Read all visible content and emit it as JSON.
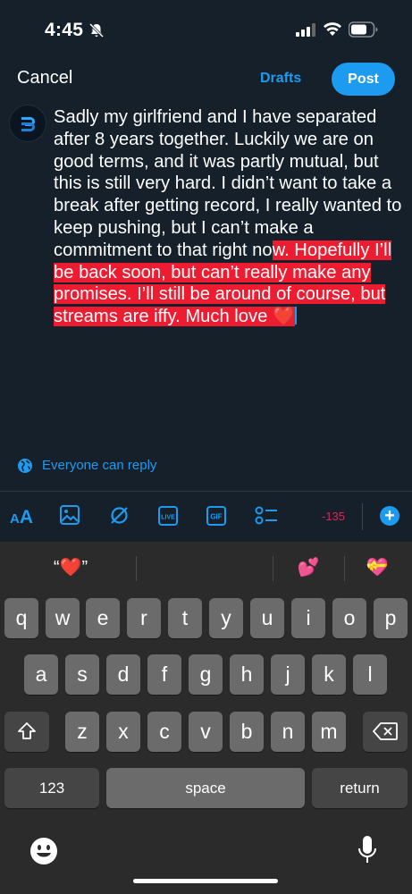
{
  "status_bar": {
    "time": "4:45"
  },
  "header": {
    "cancel_label": "Cancel",
    "drafts_label": "Drafts",
    "post_label": "Post"
  },
  "composer": {
    "text_plain": "Sadly my girlfriend and I have separated after 8 years together. Luckily we are on good terms, and it was partly mutual, but this is still very hard. I didn’t want to take a break after getting record, I really wanted to keep pushing, but I can’t make a commitment to that right no",
    "text_highlighted": "w. Hopefully I’ll be back soon, but can’t really make any promises. I’ll still be around of course, but streams are iffy. Much love ❤️"
  },
  "reply_setting": {
    "label": "Everyone can reply",
    "icon": "globe-icon"
  },
  "toolbar": {
    "text_size_label": "A",
    "text_size_small_label": "A",
    "char_count": "-135",
    "icons": [
      "text-size-icon",
      "image-icon",
      "gif-search-icon",
      "live-icon",
      "gif-icon",
      "poll-icon",
      "add-thread-icon"
    ],
    "live_label": "LIVE",
    "gif_label": "GIF"
  },
  "keyboard": {
    "suggestions": [
      "“❤️”",
      "💕",
      "💝"
    ],
    "row1": [
      "q",
      "w",
      "e",
      "r",
      "t",
      "y",
      "u",
      "i",
      "o",
      "p"
    ],
    "row2": [
      "a",
      "s",
      "d",
      "f",
      "g",
      "h",
      "j",
      "k",
      "l"
    ],
    "row3": [
      "z",
      "x",
      "c",
      "v",
      "b",
      "n",
      "m"
    ],
    "numbers_label": "123",
    "space_label": "space",
    "return_label": "return",
    "emoji_icon": "emoji-icon",
    "mic_icon": "microphone-icon"
  },
  "colors": {
    "background": "#15202b",
    "accent": "#1d9bf0",
    "highlight": "#ee1c31",
    "warning": "#e0245e"
  }
}
